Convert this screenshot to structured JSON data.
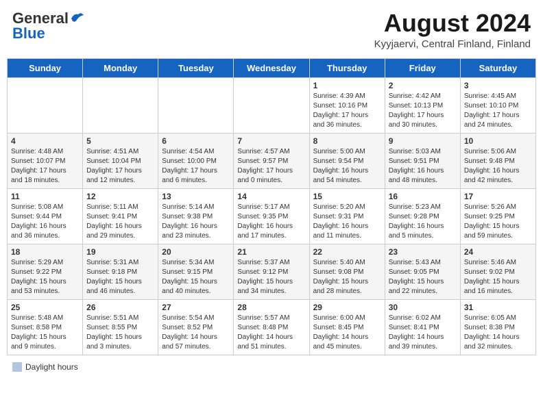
{
  "header": {
    "logo_line1": "General",
    "logo_line2": "Blue",
    "main_title": "August 2024",
    "subtitle": "Kyyjaervi, Central Finland, Finland"
  },
  "days_of_week": [
    "Sunday",
    "Monday",
    "Tuesday",
    "Wednesday",
    "Thursday",
    "Friday",
    "Saturday"
  ],
  "weeks": [
    [
      {
        "day": "",
        "info": ""
      },
      {
        "day": "",
        "info": ""
      },
      {
        "day": "",
        "info": ""
      },
      {
        "day": "",
        "info": ""
      },
      {
        "day": "1",
        "info": "Sunrise: 4:39 AM\nSunset: 10:16 PM\nDaylight: 17 hours\nand 36 minutes."
      },
      {
        "day": "2",
        "info": "Sunrise: 4:42 AM\nSunset: 10:13 PM\nDaylight: 17 hours\nand 30 minutes."
      },
      {
        "day": "3",
        "info": "Sunrise: 4:45 AM\nSunset: 10:10 PM\nDaylight: 17 hours\nand 24 minutes."
      }
    ],
    [
      {
        "day": "4",
        "info": "Sunrise: 4:48 AM\nSunset: 10:07 PM\nDaylight: 17 hours\nand 18 minutes."
      },
      {
        "day": "5",
        "info": "Sunrise: 4:51 AM\nSunset: 10:04 PM\nDaylight: 17 hours\nand 12 minutes."
      },
      {
        "day": "6",
        "info": "Sunrise: 4:54 AM\nSunset: 10:00 PM\nDaylight: 17 hours\nand 6 minutes."
      },
      {
        "day": "7",
        "info": "Sunrise: 4:57 AM\nSunset: 9:57 PM\nDaylight: 17 hours\nand 0 minutes."
      },
      {
        "day": "8",
        "info": "Sunrise: 5:00 AM\nSunset: 9:54 PM\nDaylight: 16 hours\nand 54 minutes."
      },
      {
        "day": "9",
        "info": "Sunrise: 5:03 AM\nSunset: 9:51 PM\nDaylight: 16 hours\nand 48 minutes."
      },
      {
        "day": "10",
        "info": "Sunrise: 5:06 AM\nSunset: 9:48 PM\nDaylight: 16 hours\nand 42 minutes."
      }
    ],
    [
      {
        "day": "11",
        "info": "Sunrise: 5:08 AM\nSunset: 9:44 PM\nDaylight: 16 hours\nand 36 minutes."
      },
      {
        "day": "12",
        "info": "Sunrise: 5:11 AM\nSunset: 9:41 PM\nDaylight: 16 hours\nand 29 minutes."
      },
      {
        "day": "13",
        "info": "Sunrise: 5:14 AM\nSunset: 9:38 PM\nDaylight: 16 hours\nand 23 minutes."
      },
      {
        "day": "14",
        "info": "Sunrise: 5:17 AM\nSunset: 9:35 PM\nDaylight: 16 hours\nand 17 minutes."
      },
      {
        "day": "15",
        "info": "Sunrise: 5:20 AM\nSunset: 9:31 PM\nDaylight: 16 hours\nand 11 minutes."
      },
      {
        "day": "16",
        "info": "Sunrise: 5:23 AM\nSunset: 9:28 PM\nDaylight: 16 hours\nand 5 minutes."
      },
      {
        "day": "17",
        "info": "Sunrise: 5:26 AM\nSunset: 9:25 PM\nDaylight: 15 hours\nand 59 minutes."
      }
    ],
    [
      {
        "day": "18",
        "info": "Sunrise: 5:29 AM\nSunset: 9:22 PM\nDaylight: 15 hours\nand 53 minutes."
      },
      {
        "day": "19",
        "info": "Sunrise: 5:31 AM\nSunset: 9:18 PM\nDaylight: 15 hours\nand 46 minutes."
      },
      {
        "day": "20",
        "info": "Sunrise: 5:34 AM\nSunset: 9:15 PM\nDaylight: 15 hours\nand 40 minutes."
      },
      {
        "day": "21",
        "info": "Sunrise: 5:37 AM\nSunset: 9:12 PM\nDaylight: 15 hours\nand 34 minutes."
      },
      {
        "day": "22",
        "info": "Sunrise: 5:40 AM\nSunset: 9:08 PM\nDaylight: 15 hours\nand 28 minutes."
      },
      {
        "day": "23",
        "info": "Sunrise: 5:43 AM\nSunset: 9:05 PM\nDaylight: 15 hours\nand 22 minutes."
      },
      {
        "day": "24",
        "info": "Sunrise: 5:46 AM\nSunset: 9:02 PM\nDaylight: 15 hours\nand 16 minutes."
      }
    ],
    [
      {
        "day": "25",
        "info": "Sunrise: 5:48 AM\nSunset: 8:58 PM\nDaylight: 15 hours\nand 9 minutes."
      },
      {
        "day": "26",
        "info": "Sunrise: 5:51 AM\nSunset: 8:55 PM\nDaylight: 15 hours\nand 3 minutes."
      },
      {
        "day": "27",
        "info": "Sunrise: 5:54 AM\nSunset: 8:52 PM\nDaylight: 14 hours\nand 57 minutes."
      },
      {
        "day": "28",
        "info": "Sunrise: 5:57 AM\nSunset: 8:48 PM\nDaylight: 14 hours\nand 51 minutes."
      },
      {
        "day": "29",
        "info": "Sunrise: 6:00 AM\nSunset: 8:45 PM\nDaylight: 14 hours\nand 45 minutes."
      },
      {
        "day": "30",
        "info": "Sunrise: 6:02 AM\nSunset: 8:41 PM\nDaylight: 14 hours\nand 39 minutes."
      },
      {
        "day": "31",
        "info": "Sunrise: 6:05 AM\nSunset: 8:38 PM\nDaylight: 14 hours\nand 32 minutes."
      }
    ]
  ],
  "footer": {
    "legend_label": "Daylight hours"
  }
}
